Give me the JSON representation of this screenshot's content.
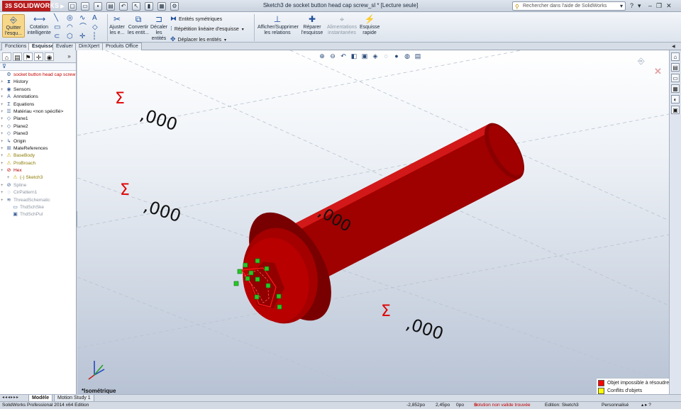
{
  "app": {
    "logo": "SOLIDWORKS",
    "window_title": "Sketch3 de socket button head cap screw_sl * [Lecture seule]",
    "help_search_placeholder": "Rechercher dans l'aide de SolidWorks"
  },
  "ribbon": {
    "exit_sketch": "Quitter l'esqu...",
    "smart_dimension": "Cotation intelligente",
    "trim": "Ajuster les e...",
    "convert": "Convertir les entit...",
    "offset": "Décaler les entités",
    "mirror": "Entités symétriques",
    "linear_pattern": "Répétition linéaire d'esquisse",
    "move": "Déplacer les entités",
    "relations": "Afficher/Supprimer les relations",
    "repair": "Réparer l'esquisse",
    "quick_snaps": "Alimentations instantanées",
    "rapid_sketch": "Esquisse rapide"
  },
  "tabs": [
    "Fonctions",
    "Esquisse",
    "Evaluer",
    "DimXpert",
    "Produits Office"
  ],
  "active_tab": "Esquisse",
  "tree": [
    {
      "label": "socket button head cap screw",
      "icon": "part-icon",
      "kind": "root"
    },
    {
      "label": "History",
      "icon": "history-icon",
      "kind": "normal"
    },
    {
      "label": "Sensors",
      "icon": "sensor-icon",
      "kind": "normal"
    },
    {
      "label": "Annotations",
      "icon": "annotation-icon",
      "kind": "normal"
    },
    {
      "label": "Equations",
      "icon": "equation-icon",
      "kind": "normal"
    },
    {
      "label": "Matériau <non spécifié>",
      "icon": "material-icon",
      "kind": "normal"
    },
    {
      "label": "Plane1",
      "icon": "plane-icon",
      "kind": "normal"
    },
    {
      "label": "Plane2",
      "icon": "plane-icon",
      "kind": "normal"
    },
    {
      "label": "Plane3",
      "icon": "plane-icon",
      "kind": "normal"
    },
    {
      "label": "Origin",
      "icon": "origin-icon",
      "kind": "normal"
    },
    {
      "label": "MateReferences",
      "icon": "mate-icon",
      "kind": "normal"
    },
    {
      "label": "BaseBody",
      "icon": "warning-icon",
      "kind": "warn"
    },
    {
      "label": "ProBroach",
      "icon": "warning-icon",
      "kind": "warn"
    },
    {
      "label": "Hex",
      "icon": "error-icon",
      "kind": "err"
    },
    {
      "label": "(-) Sketch3",
      "icon": "warning-icon",
      "kind": "warn"
    },
    {
      "label": "Spline",
      "icon": "error-icon",
      "kind": "grey"
    },
    {
      "label": "CirPattern1",
      "icon": "pattern-icon",
      "kind": "grey"
    },
    {
      "label": "ThreadSchematic",
      "icon": "thread-icon",
      "kind": "grey"
    },
    {
      "label": "ThdSchSke",
      "icon": "sketch-icon",
      "kind": "grey"
    },
    {
      "label": "ThdSchPul",
      "icon": "feature-icon",
      "kind": "grey"
    }
  ],
  "viewport": {
    "dimension_labels": [
      ",000",
      ",000",
      ",000",
      ",000"
    ],
    "sigma_symbol": "Σ",
    "view_orientation": "*Isométrique",
    "legend": [
      {
        "label": "Objet impossible à résoudre",
        "color": "#ff0000"
      },
      {
        "label": "Conflits d'objets",
        "color": "#ffff00"
      }
    ],
    "model_color": "#b50000"
  },
  "bottom_tabs": [
    "Modèle",
    "Motion Study 1"
  ],
  "status": {
    "edition": "SolidWorks Professional 2014 x64 Edition",
    "x": "-2,852po",
    "y": "2,45po",
    "z": "0po",
    "solution": "Solution non valide trouvée",
    "editing": "Edition: Sketch3",
    "units": "Personnalisé"
  }
}
